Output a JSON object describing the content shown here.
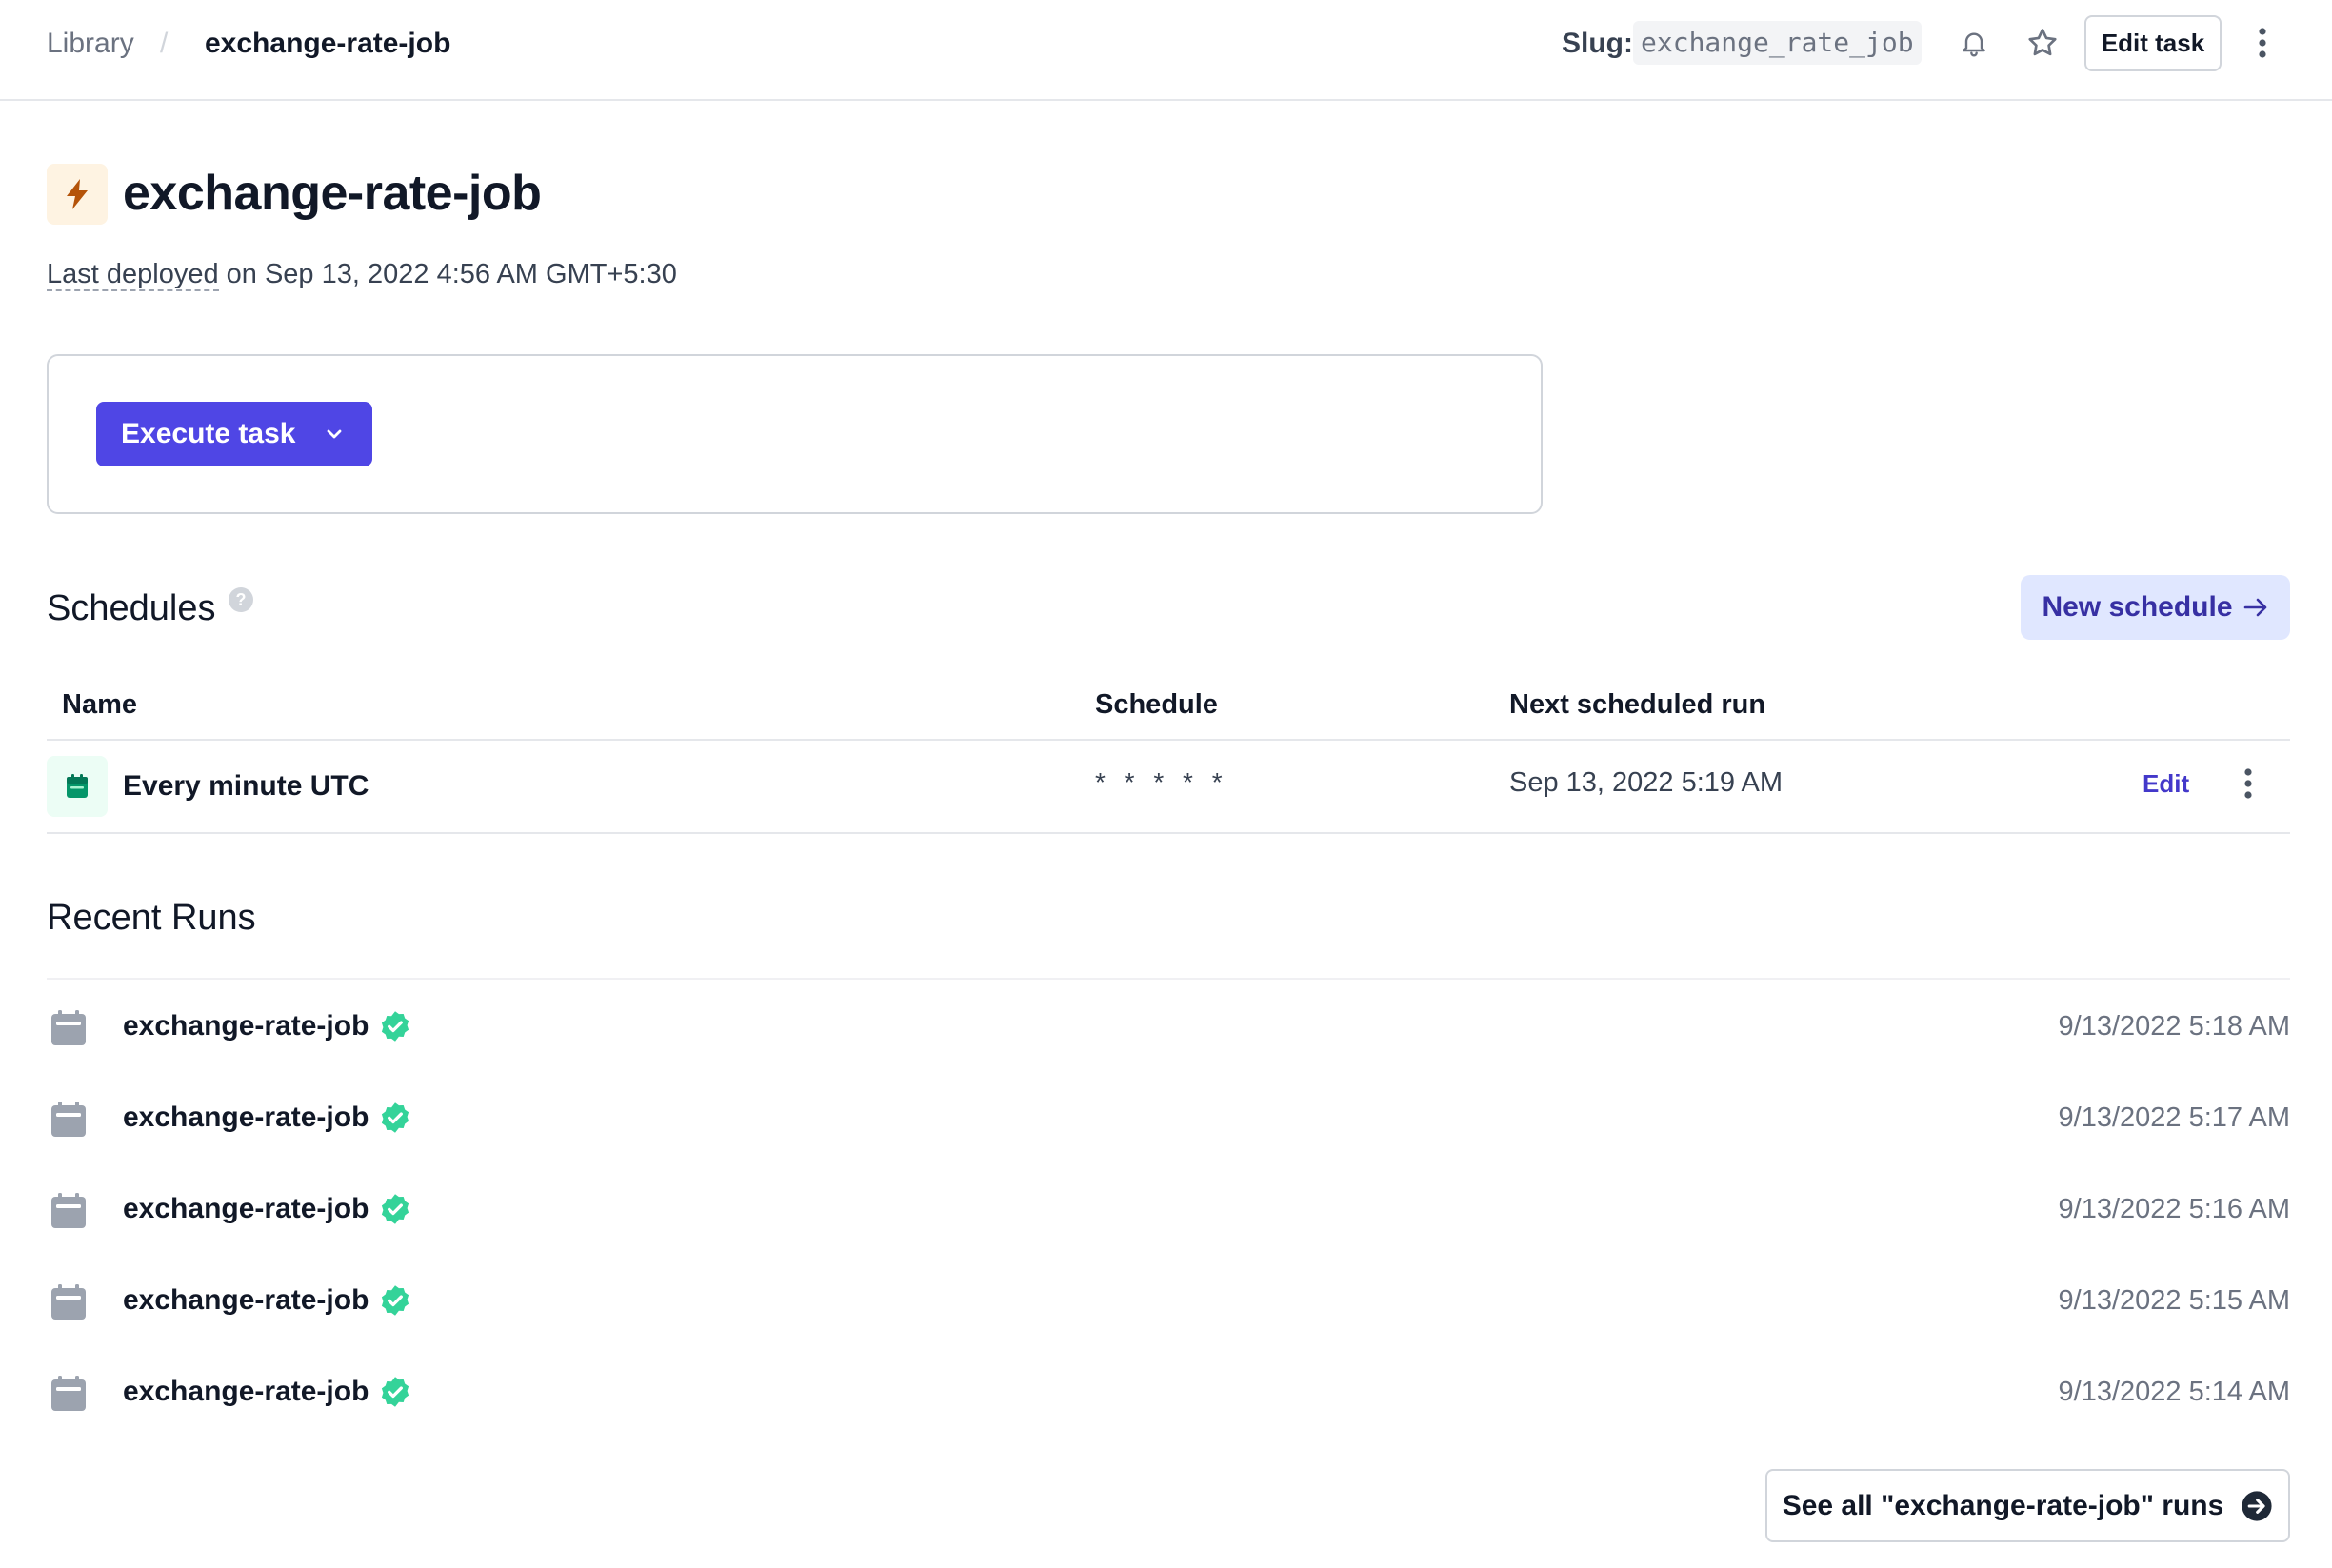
{
  "breadcrumb": {
    "library": "Library",
    "separator": "/",
    "current": "exchange-rate-job"
  },
  "slug": {
    "label": "Slug:",
    "value": "exchange_rate_job"
  },
  "toolbar": {
    "edit_task_label": "Edit task",
    "icons": [
      "bell-icon",
      "star-icon",
      "kebab-menu-icon"
    ]
  },
  "task": {
    "title": "exchange-rate-job",
    "deployed_prefix": "Last deployed",
    "deployed_suffix": " on Sep 13, 2022 4:56 AM GMT+5:30",
    "icon": "lightning-bolt-icon",
    "icon_color": "#b45309"
  },
  "execute": {
    "label": "Execute task",
    "accent": "#4f46e5"
  },
  "schedules": {
    "title": "Schedules",
    "help": "?",
    "new_schedule_label": "New schedule",
    "columns": [
      "Name",
      "Schedule",
      "Next scheduled run"
    ],
    "rows": [
      {
        "name": "Every minute UTC",
        "schedule": "* * * * *",
        "next": "Sep 13, 2022 5:19 AM",
        "edit_label": "Edit"
      }
    ]
  },
  "recent_runs": {
    "title": "Recent Runs",
    "status_color": "#34d399",
    "runs": [
      {
        "name": "exchange-rate-job",
        "status": "success",
        "time": "9/13/2022 5:18 AM"
      },
      {
        "name": "exchange-rate-job",
        "status": "success",
        "time": "9/13/2022 5:17 AM"
      },
      {
        "name": "exchange-rate-job",
        "status": "success",
        "time": "9/13/2022 5:16 AM"
      },
      {
        "name": "exchange-rate-job",
        "status": "success",
        "time": "9/13/2022 5:15 AM"
      },
      {
        "name": "exchange-rate-job",
        "status": "success",
        "time": "9/13/2022 5:14 AM"
      }
    ],
    "see_all_label": "See all \"exchange-rate-job\" runs"
  }
}
